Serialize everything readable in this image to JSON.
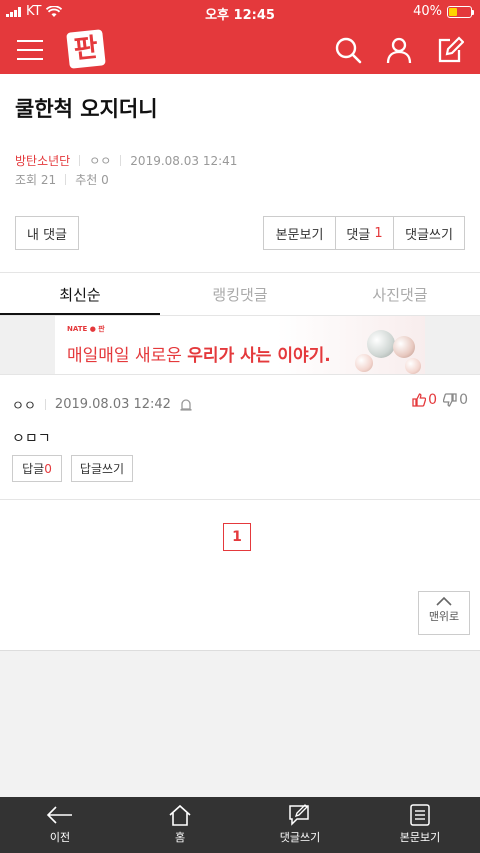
{
  "status_bar": {
    "carrier": "KT",
    "time": "오후 12:45",
    "battery_percent": "40%",
    "battery_level": 0.4
  },
  "header": {
    "logo_text": "판"
  },
  "post": {
    "title": "쿨한척 오지더니",
    "author": "방탄소년단",
    "writer": "ㅇㅇ",
    "datetime": "2019.08.03 12:41",
    "views_label": "조회",
    "views": "21",
    "recommend_label": "추천",
    "recommend": "0"
  },
  "actions": {
    "my_comments": "내 댓글",
    "view_body": "본문보기",
    "comments_label": "댓글",
    "comments_count": "1",
    "write_comment": "댓글쓰기"
  },
  "tabs": [
    {
      "label": "최신순",
      "active": true
    },
    {
      "label": "랭킹댓글",
      "active": false
    },
    {
      "label": "사진댓글",
      "active": false
    }
  ],
  "banner": {
    "brand": "NATE ● 판",
    "slogan_prefix": "매일매일 새로운 ",
    "slogan_bold": "우리가 사는 이야기."
  },
  "comment": {
    "writer": "ㅇㅇ",
    "datetime": "2019.08.03 12:42",
    "up": "0",
    "down": "0",
    "body": "ㅇㅁㄱ",
    "reply_label": "답글",
    "reply_count": "0",
    "write_reply": "답글쓰기"
  },
  "pagination": {
    "current_page": "1"
  },
  "to_top": "맨위로",
  "bottom_nav": [
    {
      "label": "이전",
      "icon": "back-arrow-icon"
    },
    {
      "label": "홈",
      "icon": "home-icon"
    },
    {
      "label": "댓글쓰기",
      "icon": "comment-write-icon"
    },
    {
      "label": "본문보기",
      "icon": "document-icon"
    }
  ],
  "colors": {
    "brand_red": "#e4393c",
    "nav_bg": "#333333"
  }
}
